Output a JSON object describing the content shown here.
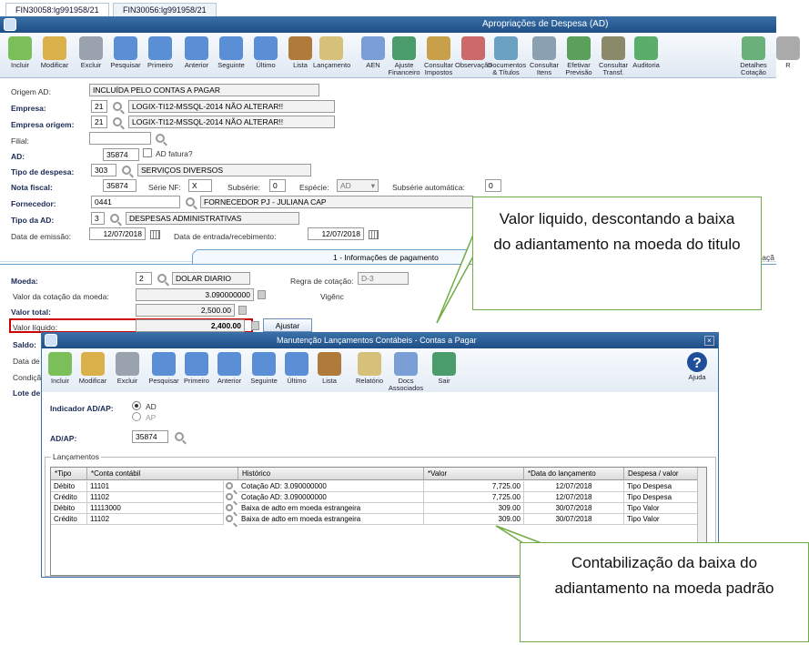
{
  "tabs": [
    "FIN30058:lg991958/21",
    "FIN30056:lg991958/21"
  ],
  "window": {
    "title": "Apropriações de Despesa (AD)"
  },
  "toolbar": [
    "Incluir",
    "Modificar",
    "Excluir",
    "Pesquisar",
    "Primeiro",
    "Anterior",
    "Seguinte",
    "Último",
    "Lista",
    "Lançamento",
    "AEN",
    "Ajuste Financeiro",
    "Consultar Impostos",
    "Observação",
    "Documentos & Títulos",
    "Consultar Itens",
    "Efetivar Previsão",
    "Consultar Transf.",
    "Auditoria",
    "Detalhes Cotação",
    "R"
  ],
  "form": {
    "origem_ad_label": "Origem AD:",
    "origem_ad": "INCLUÍDA PELO CONTAS A PAGAR",
    "empresa_label": "Empresa:",
    "empresa_code": "21",
    "empresa_name": "LOGIX-TI12-MSSQL-2014 NÃO ALTERAR!!",
    "empresa_origem_label": "Empresa origem:",
    "empresa_origem_code": "21",
    "empresa_origem_name": "LOGIX-TI12-MSSQL-2014 NÃO ALTERAR!!",
    "filial_label": "Filial:",
    "filial": "",
    "ad_label": "AD:",
    "ad": "35874",
    "ad_fatura_label": "AD fatura?",
    "tipo_despesa_label": "Tipo de despesa:",
    "tipo_despesa_code": "303",
    "tipo_despesa_name": "SERVIÇOS DIVERSOS",
    "nota_fiscal_label": "Nota fiscal:",
    "nota_fiscal": "35874",
    "serie_nf_label": "Série NF:",
    "serie_nf": "X",
    "subserie_label": "Subsérie:",
    "subserie": "0",
    "especie_label": "Espécie:",
    "especie": "AD",
    "subserie_auto_label": "Subsérie automática:",
    "subserie_auto": "0",
    "fornecedor_label": "Fornecedor:",
    "fornecedor_code": "0441",
    "fornecedor_name": "FORNECEDOR PJ - JULIANA CAP",
    "tipo_ad_label": "Tipo da AD:",
    "tipo_ad_code": "3",
    "tipo_ad_name": "DESPESAS ADMINISTRATIVAS",
    "data_emissao_label": "Data de emissão:",
    "data_emissao": "12/07/2018",
    "data_entrada_label": "Data de entrada/recebimento:",
    "data_entrada": "12/07/2018",
    "section_tab": "1 - Informações de pagamento",
    "side_tab_fragment": "vaçã",
    "moeda_label": "Moeda:",
    "moeda_code": "2",
    "moeda_name": "DOLAR DIARIO",
    "regra_cotacao_label": "Regra de cotação:",
    "regra_cotacao": "D-3",
    "valor_cotacao_label": "Valor da cotação da moeda:",
    "valor_cotacao": "3.090000000",
    "vigencia_label": "Vigênc",
    "valor_total_label": "Valor total:",
    "valor_total": "2,500.00",
    "valor_liquido_label": "Valor líquido:",
    "valor_liquido": "2,400.00",
    "ajustar_label": "Ajustar",
    "saldo_label": "Saldo:",
    "data_de_label": "Data de",
    "condicao_label": "Condiçã",
    "lote_label": "Lote de"
  },
  "dialog": {
    "title": "Manutenção Lançamentos Contábeis - Contas a Pagar",
    "toolbar": [
      "Incluir",
      "Modificar",
      "Excluir",
      "Pesquisar",
      "Primeiro",
      "Anterior",
      "Seguinte",
      "Último",
      "Lista",
      "Relatório",
      "Docs Associados",
      "Sair"
    ],
    "help_label": "Ajuda",
    "indicador_label": "Indicador AD/AP:",
    "opt_ad": "AD",
    "opt_ap": "AP",
    "adap_label": "AD/AP:",
    "adap": "35874",
    "group_label": "Lançamentos",
    "columns": [
      "*Tipo",
      "*Conta contábil",
      "Histórico",
      "*Valor",
      "*Data do lançamento",
      "Despesa / valor"
    ],
    "rows": [
      [
        "Débito",
        "11101",
        "Cotação AD: 3.090000000",
        "7,725.00",
        "12/07/2018",
        "Tipo Despesa"
      ],
      [
        "Crédito",
        "11102",
        "Cotação AD: 3.090000000",
        "7,725.00",
        "12/07/2018",
        "Tipo Despesa"
      ],
      [
        "Débito",
        "11113000",
        "Baixa de adto em moeda estrangeira",
        "309.00",
        "30/07/2018",
        "Tipo Valor"
      ],
      [
        "Crédito",
        "11102",
        "Baixa de adto em moeda estrangeira",
        "309.00",
        "30/07/2018",
        "Tipo Valor"
      ]
    ]
  },
  "callouts": {
    "top": "Valor liquido, descontando a baixa do adiantamento na moeda do titulo",
    "bottom": "Contabilização da baixa do adiantamento na moeda padrão"
  },
  "colors": {
    "title_bar": "#1e4f86",
    "highlight": "#cc0000",
    "callout_border": "#70ad47"
  }
}
